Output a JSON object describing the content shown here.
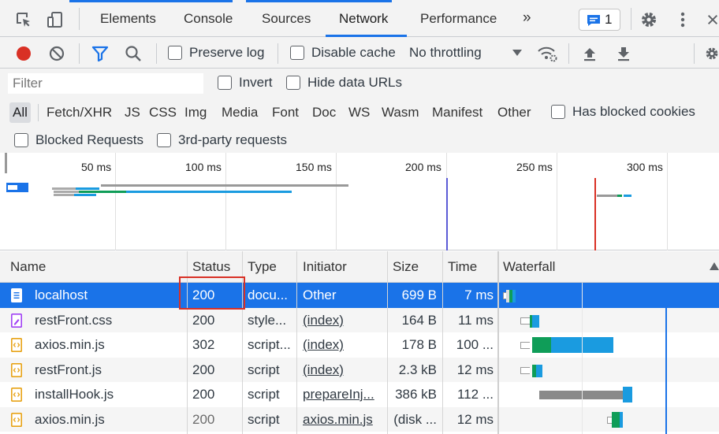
{
  "tabs": {
    "items": [
      "Elements",
      "Console",
      "Sources",
      "Network",
      "Performance"
    ],
    "more": "»",
    "issues_badge": "1"
  },
  "toolbar": {
    "preserve_log": "Preserve log",
    "disable_cache": "Disable cache",
    "throttling": "No throttling"
  },
  "filter": {
    "placeholder": "Filter",
    "invert": "Invert",
    "hide_data_urls": "Hide data URLs",
    "types": [
      "All",
      "Fetch/XHR",
      "JS",
      "CSS",
      "Img",
      "Media",
      "Font",
      "Doc",
      "WS",
      "Wasm",
      "Manifest",
      "Other"
    ],
    "has_blocked_cookies": "Has blocked cookies",
    "blocked_requests": "Blocked Requests",
    "third_party": "3rd-party requests"
  },
  "overview": {
    "ticks": [
      "50 ms",
      "100 ms",
      "150 ms",
      "200 ms",
      "250 ms",
      "300 ms"
    ]
  },
  "table": {
    "columns": [
      "Name",
      "Status",
      "Type",
      "Initiator",
      "Size",
      "Time",
      "Waterfall"
    ],
    "rows": [
      {
        "name": "localhost",
        "status": "200",
        "type": "docu...",
        "initiator": "Other",
        "size": "699 B",
        "time": "7 ms",
        "icon": "document-icon"
      },
      {
        "name": "restFront.css",
        "status": "200",
        "type": "style...",
        "initiator": "(index)",
        "size": "164 B",
        "time": "11 ms",
        "icon": "stylesheet-icon"
      },
      {
        "name": "axios.min.js",
        "status": "302",
        "type": "script...",
        "initiator": "(index)",
        "size": "178 B",
        "time": "100 ...",
        "icon": "script-icon"
      },
      {
        "name": "restFront.js",
        "status": "200",
        "type": "script",
        "initiator": "(index)",
        "size": "2.3 kB",
        "time": "12 ms",
        "icon": "script-icon"
      },
      {
        "name": "installHook.js",
        "status": "200",
        "type": "script",
        "initiator": "prepareInj...",
        "size": "386 kB",
        "time": "112 ...",
        "icon": "script-icon"
      },
      {
        "name": "axios.min.js",
        "status": "200",
        "type": "script",
        "initiator": "axios.min.js",
        "size": "(disk ...",
        "time": "12 ms",
        "icon": "script-icon"
      }
    ]
  },
  "colors": {
    "accent": "#1a73e8",
    "record": "#d93025",
    "highlight_box": "#d93025",
    "waiting_green": "#0f9d58",
    "download_blue": "#1a9be0"
  }
}
